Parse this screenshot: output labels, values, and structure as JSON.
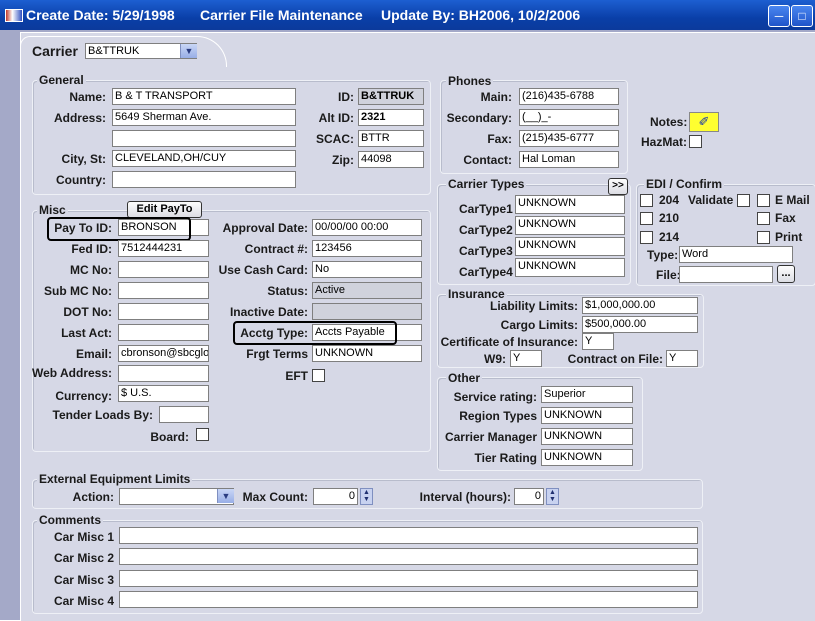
{
  "titlebar": {
    "create": "Create Date: 5/29/1998",
    "app": "Carrier File Maintenance",
    "update": "Update By: BH2006, 10/2/2006"
  },
  "carrier_tab": {
    "label": "Carrier",
    "value": "B&TTRUK"
  },
  "general": {
    "title": "General",
    "name_label": "Name:",
    "name": "B & T TRANSPORT",
    "address_label": "Address:",
    "address1": "5649 Sherman Ave.",
    "address2": "",
    "city_label": "City, St:",
    "city": "CLEVELAND,OH/CUY",
    "country_label": "Country:",
    "country": "",
    "id_label": "ID:",
    "id": "B&TTRUK",
    "altid_label": "Alt ID:",
    "altid": "2321",
    "scac_label": "SCAC:",
    "scac": "BTTR",
    "zip_label": "Zip:",
    "zip": "44098"
  },
  "phones": {
    "title": "Phones",
    "main_label": "Main:",
    "main": "(216)435-6788",
    "secondary_label": "Secondary:",
    "secondary": "(__)_-",
    "fax_label": "Fax:",
    "fax": "(215)435-6777",
    "contact_label": "Contact:",
    "contact": "Hal Loman"
  },
  "notes": {
    "label": "Notes:",
    "hazmat": "HazMat:"
  },
  "carrier_types": {
    "title": "Carrier Types",
    "more": ">>",
    "labels": [
      "CarType1",
      "CarType2",
      "CarType3",
      "CarType4"
    ],
    "values": [
      "UNKNOWN",
      "UNKNOWN",
      "UNKNOWN",
      "UNKNOWN"
    ]
  },
  "edi": {
    "title": "EDI / Confirm",
    "c204": "204",
    "c210": "210",
    "c214": "214",
    "validate": "Validate",
    "email": "E Mail",
    "fax": "Fax",
    "print": "Print",
    "type_label": "Type:",
    "type": "Word",
    "file_label": "File:",
    "file": "",
    "browse": "..."
  },
  "misc": {
    "title": "Misc",
    "edit_payto": "Edit PayTo",
    "payto_label": "Pay To ID:",
    "payto": "BRONSON",
    "fedid_label": "Fed ID:",
    "fedid": "7512444231",
    "mcno_label": "MC No:",
    "mcno": "",
    "submc_label": "Sub MC No:",
    "submc": "",
    "dot_label": "DOT No:",
    "dot": "",
    "lastact_label": "Last Act:",
    "lastact": "",
    "email_label": "Email:",
    "email": "cbronson@sbcglob",
    "web_label": "Web Address:",
    "web": "",
    "currency_label": "Currency:",
    "currency": "$ U.S.",
    "tender_label": "Tender Loads By:",
    "tender": "",
    "board_label": "Board:",
    "approval_label": "Approval Date:",
    "approval": "00/00/00 00:00",
    "contract_label": "Contract #:",
    "contract": "123456",
    "cash_label": "Use Cash Card:",
    "cash": "No",
    "status_label": "Status:",
    "status": "Active",
    "inactive_label": "Inactive Date:",
    "inactive": "",
    "acctg_label": "Acctg Type:",
    "acctg": "Accts Payable",
    "frgt_label": "Frgt Terms",
    "frgt": "UNKNOWN",
    "eft_label": "EFT"
  },
  "insurance": {
    "title": "Insurance",
    "liability_label": "Liability Limits:",
    "liability": "$1,000,000.00",
    "cargo_label": "Cargo Limits:",
    "cargo": "$500,000.00",
    "cert_label": "Certificate of Insurance:",
    "cert": "Y",
    "w9_label": "W9:",
    "w9": "Y",
    "contract_label": "Contract on File:",
    "contract": "Y"
  },
  "other": {
    "title": "Other",
    "service_label": "Service rating:",
    "service": "Superior",
    "region_label": "Region Types",
    "region": "UNKNOWN",
    "manager_label": "Carrier Manager",
    "manager": "UNKNOWN",
    "tier_label": "Tier Rating",
    "tier": "UNKNOWN"
  },
  "equipment": {
    "title": "External Equipment Limits",
    "action_label": "Action:",
    "action": "",
    "maxcount_label": "Max Count:",
    "maxcount": "0",
    "interval_label": "Interval (hours):",
    "interval": "0"
  },
  "comments": {
    "title": "Comments",
    "labels": [
      "Car Misc 1",
      "Car Misc 2",
      "Car Misc 3",
      "Car Misc 4"
    ],
    "values": [
      "",
      "",
      "",
      ""
    ]
  }
}
